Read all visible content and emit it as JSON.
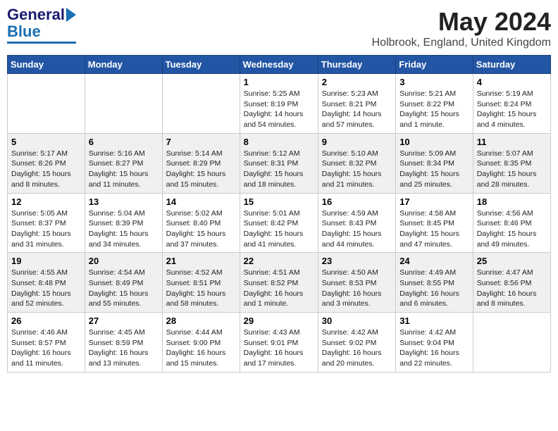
{
  "logo": {
    "general": "General",
    "blue": "Blue"
  },
  "title": "May 2024",
  "location": "Holbrook, England, United Kingdom",
  "days_of_week": [
    "Sunday",
    "Monday",
    "Tuesday",
    "Wednesday",
    "Thursday",
    "Friday",
    "Saturday"
  ],
  "weeks": [
    [
      {
        "num": "",
        "info": ""
      },
      {
        "num": "",
        "info": ""
      },
      {
        "num": "",
        "info": ""
      },
      {
        "num": "1",
        "info": "Sunrise: 5:25 AM\nSunset: 8:19 PM\nDaylight: 14 hours and 54 minutes."
      },
      {
        "num": "2",
        "info": "Sunrise: 5:23 AM\nSunset: 8:21 PM\nDaylight: 14 hours and 57 minutes."
      },
      {
        "num": "3",
        "info": "Sunrise: 5:21 AM\nSunset: 8:22 PM\nDaylight: 15 hours and 1 minute."
      },
      {
        "num": "4",
        "info": "Sunrise: 5:19 AM\nSunset: 8:24 PM\nDaylight: 15 hours and 4 minutes."
      }
    ],
    [
      {
        "num": "5",
        "info": "Sunrise: 5:17 AM\nSunset: 8:26 PM\nDaylight: 15 hours and 8 minutes."
      },
      {
        "num": "6",
        "info": "Sunrise: 5:16 AM\nSunset: 8:27 PM\nDaylight: 15 hours and 11 minutes."
      },
      {
        "num": "7",
        "info": "Sunrise: 5:14 AM\nSunset: 8:29 PM\nDaylight: 15 hours and 15 minutes."
      },
      {
        "num": "8",
        "info": "Sunrise: 5:12 AM\nSunset: 8:31 PM\nDaylight: 15 hours and 18 minutes."
      },
      {
        "num": "9",
        "info": "Sunrise: 5:10 AM\nSunset: 8:32 PM\nDaylight: 15 hours and 21 minutes."
      },
      {
        "num": "10",
        "info": "Sunrise: 5:09 AM\nSunset: 8:34 PM\nDaylight: 15 hours and 25 minutes."
      },
      {
        "num": "11",
        "info": "Sunrise: 5:07 AM\nSunset: 8:35 PM\nDaylight: 15 hours and 28 minutes."
      }
    ],
    [
      {
        "num": "12",
        "info": "Sunrise: 5:05 AM\nSunset: 8:37 PM\nDaylight: 15 hours and 31 minutes."
      },
      {
        "num": "13",
        "info": "Sunrise: 5:04 AM\nSunset: 8:39 PM\nDaylight: 15 hours and 34 minutes."
      },
      {
        "num": "14",
        "info": "Sunrise: 5:02 AM\nSunset: 8:40 PM\nDaylight: 15 hours and 37 minutes."
      },
      {
        "num": "15",
        "info": "Sunrise: 5:01 AM\nSunset: 8:42 PM\nDaylight: 15 hours and 41 minutes."
      },
      {
        "num": "16",
        "info": "Sunrise: 4:59 AM\nSunset: 8:43 PM\nDaylight: 15 hours and 44 minutes."
      },
      {
        "num": "17",
        "info": "Sunrise: 4:58 AM\nSunset: 8:45 PM\nDaylight: 15 hours and 47 minutes."
      },
      {
        "num": "18",
        "info": "Sunrise: 4:56 AM\nSunset: 8:46 PM\nDaylight: 15 hours and 49 minutes."
      }
    ],
    [
      {
        "num": "19",
        "info": "Sunrise: 4:55 AM\nSunset: 8:48 PM\nDaylight: 15 hours and 52 minutes."
      },
      {
        "num": "20",
        "info": "Sunrise: 4:54 AM\nSunset: 8:49 PM\nDaylight: 15 hours and 55 minutes."
      },
      {
        "num": "21",
        "info": "Sunrise: 4:52 AM\nSunset: 8:51 PM\nDaylight: 15 hours and 58 minutes."
      },
      {
        "num": "22",
        "info": "Sunrise: 4:51 AM\nSunset: 8:52 PM\nDaylight: 16 hours and 1 minute."
      },
      {
        "num": "23",
        "info": "Sunrise: 4:50 AM\nSunset: 8:53 PM\nDaylight: 16 hours and 3 minutes."
      },
      {
        "num": "24",
        "info": "Sunrise: 4:49 AM\nSunset: 8:55 PM\nDaylight: 16 hours and 6 minutes."
      },
      {
        "num": "25",
        "info": "Sunrise: 4:47 AM\nSunset: 8:56 PM\nDaylight: 16 hours and 8 minutes."
      }
    ],
    [
      {
        "num": "26",
        "info": "Sunrise: 4:46 AM\nSunset: 8:57 PM\nDaylight: 16 hours and 11 minutes."
      },
      {
        "num": "27",
        "info": "Sunrise: 4:45 AM\nSunset: 8:59 PM\nDaylight: 16 hours and 13 minutes."
      },
      {
        "num": "28",
        "info": "Sunrise: 4:44 AM\nSunset: 9:00 PM\nDaylight: 16 hours and 15 minutes."
      },
      {
        "num": "29",
        "info": "Sunrise: 4:43 AM\nSunset: 9:01 PM\nDaylight: 16 hours and 17 minutes."
      },
      {
        "num": "30",
        "info": "Sunrise: 4:42 AM\nSunset: 9:02 PM\nDaylight: 16 hours and 20 minutes."
      },
      {
        "num": "31",
        "info": "Sunrise: 4:42 AM\nSunset: 9:04 PM\nDaylight: 16 hours and 22 minutes."
      },
      {
        "num": "",
        "info": ""
      }
    ]
  ]
}
